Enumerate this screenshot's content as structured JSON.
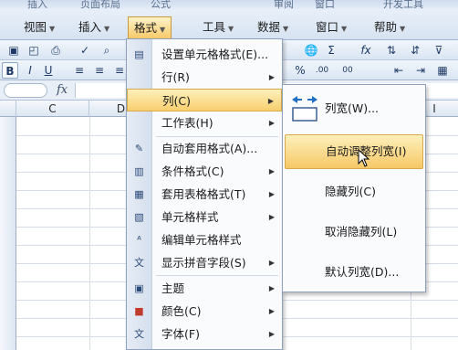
{
  "menubar": {
    "top_strip": [
      "插入",
      "页面布局",
      "公式",
      "审阅",
      "窗口",
      "开发工具"
    ],
    "items": [
      {
        "label": "视图",
        "name": "view"
      },
      {
        "label": "插入",
        "name": "insert"
      },
      {
        "label": "格式",
        "name": "format"
      },
      {
        "label": "工具",
        "name": "tools"
      },
      {
        "label": "数据",
        "name": "data"
      },
      {
        "label": "窗口",
        "name": "window"
      },
      {
        "label": "帮助",
        "name": "help"
      }
    ]
  },
  "toolbar": {
    "bold": "B",
    "italic": "I",
    "underline": "U",
    "sum": "Σ",
    "fx": "fx",
    "percent": "%",
    "dec_inc": ".00",
    "dec_dec": "00"
  },
  "formula_bar": {
    "fx_label": "fx"
  },
  "columns": [
    "C",
    "D",
    "I"
  ],
  "format_menu": {
    "items": [
      {
        "label": "设置单元格格式(E)...",
        "icon": "format-cells-icon",
        "submenu": false
      },
      {
        "label": "行(R)",
        "icon": "",
        "submenu": true
      },
      {
        "label": "列(C)",
        "icon": "",
        "submenu": true,
        "highlight": true
      },
      {
        "label": "工作表(H)",
        "icon": "",
        "submenu": true
      },
      {
        "label": "自动套用格式(A)...",
        "icon": "autoformat-icon",
        "submenu": false
      },
      {
        "label": "条件格式(C)",
        "icon": "conditional-format-icon",
        "submenu": true
      },
      {
        "label": "套用表格格式(T)",
        "icon": "table-style-icon",
        "submenu": true
      },
      {
        "label": "单元格样式",
        "icon": "cell-style-icon",
        "submenu": true
      },
      {
        "label": "编辑单元格样式",
        "icon": "edit-cell-style-icon",
        "submenu": false
      },
      {
        "label": "显示拼音字段(S)",
        "icon": "phonetic-icon",
        "submenu": true
      },
      {
        "label": "主题",
        "icon": "theme-icon",
        "submenu": true
      },
      {
        "label": "颜色(C)",
        "icon": "color-icon",
        "submenu": true
      },
      {
        "label": "字体(F)",
        "icon": "font-icon",
        "submenu": true
      }
    ]
  },
  "column_submenu": {
    "items": [
      {
        "label": "列宽(W)...",
        "icon": "column-width-icon"
      },
      {
        "label": "自动调整列宽(I)",
        "highlight": true
      },
      {
        "label": "隐藏列(C)"
      },
      {
        "label": "取消隐藏列(L)"
      },
      {
        "label": "默认列宽(D)..."
      }
    ]
  },
  "colors": {
    "highlight_top": "#fdf0bb",
    "highlight_bottom": "#f8cf6f",
    "highlight_border": "#d9a84b",
    "menu_bg": "#fafbfd",
    "ribbon_blue": "#d7e3f2"
  }
}
